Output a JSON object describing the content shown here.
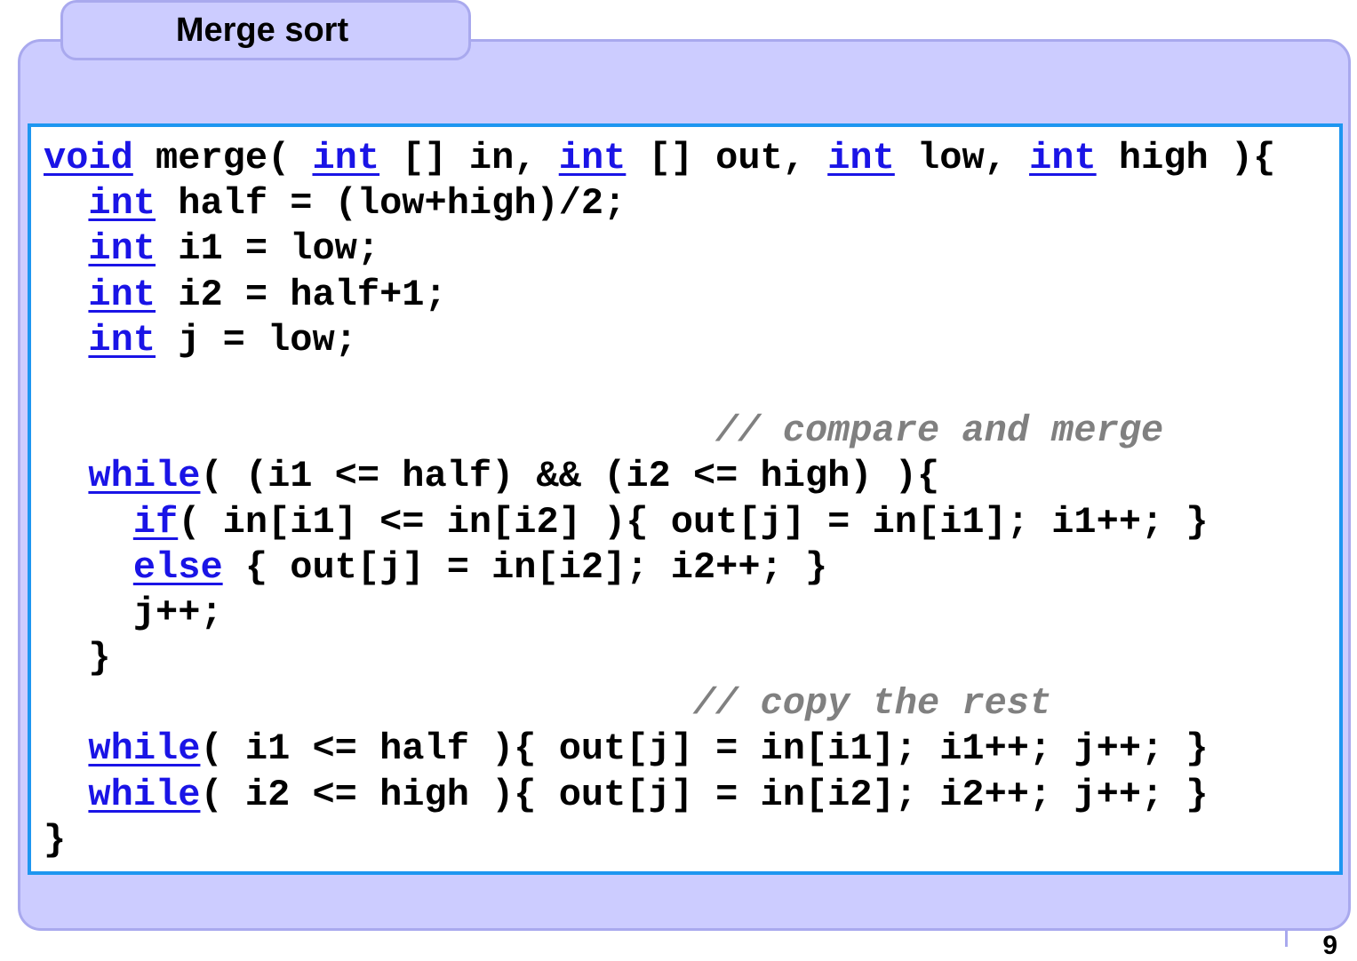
{
  "slide": {
    "title": "Merge sort",
    "page_number": "9"
  },
  "code_lines": [
    [
      {
        "t": "void",
        "k": "kw"
      },
      {
        "t": " merge( "
      },
      {
        "t": "int",
        "k": "kw"
      },
      {
        "t": " [] in, "
      },
      {
        "t": "int",
        "k": "kw"
      },
      {
        "t": " [] out, "
      },
      {
        "t": "int",
        "k": "kw"
      },
      {
        "t": " low, "
      },
      {
        "t": "int",
        "k": "kw"
      },
      {
        "t": " high ){"
      }
    ],
    [
      {
        "t": "  "
      },
      {
        "t": "int",
        "k": "kw"
      },
      {
        "t": " half = (low+high)/2;"
      }
    ],
    [
      {
        "t": "  "
      },
      {
        "t": "int",
        "k": "kw"
      },
      {
        "t": " i1 = low;"
      }
    ],
    [
      {
        "t": "  "
      },
      {
        "t": "int",
        "k": "kw"
      },
      {
        "t": " i2 = half+1;"
      }
    ],
    [
      {
        "t": "  "
      },
      {
        "t": "int",
        "k": "kw"
      },
      {
        "t": " j = low;"
      }
    ],
    [],
    [
      {
        "t": "                              "
      },
      {
        "t": "// compare and merge",
        "k": "comment"
      }
    ],
    [
      {
        "t": "  "
      },
      {
        "t": "while",
        "k": "kw"
      },
      {
        "t": "( (i1 <= half) && (i2 <= high) ){"
      }
    ],
    [
      {
        "t": "    "
      },
      {
        "t": "if",
        "k": "kw"
      },
      {
        "t": "( in[i1] <= in[i2] ){ out[j] = in[i1]; i1++; }"
      }
    ],
    [
      {
        "t": "    "
      },
      {
        "t": "else",
        "k": "kw"
      },
      {
        "t": " { out[j] = in[i2]; i2++; }"
      }
    ],
    [
      {
        "t": "    j++;"
      }
    ],
    [
      {
        "t": "  }"
      }
    ],
    [
      {
        "t": "                             "
      },
      {
        "t": "// copy the rest",
        "k": "comment"
      }
    ],
    [
      {
        "t": "  "
      },
      {
        "t": "while",
        "k": "kw"
      },
      {
        "t": "( i1 <= half ){ out[j] = in[i1]; i1++; j++; }"
      }
    ],
    [
      {
        "t": "  "
      },
      {
        "t": "while",
        "k": "kw"
      },
      {
        "t": "( i2 <= high ){ out[j] = in[i2]; i2++; j++; }"
      }
    ],
    [
      {
        "t": "}"
      }
    ]
  ]
}
